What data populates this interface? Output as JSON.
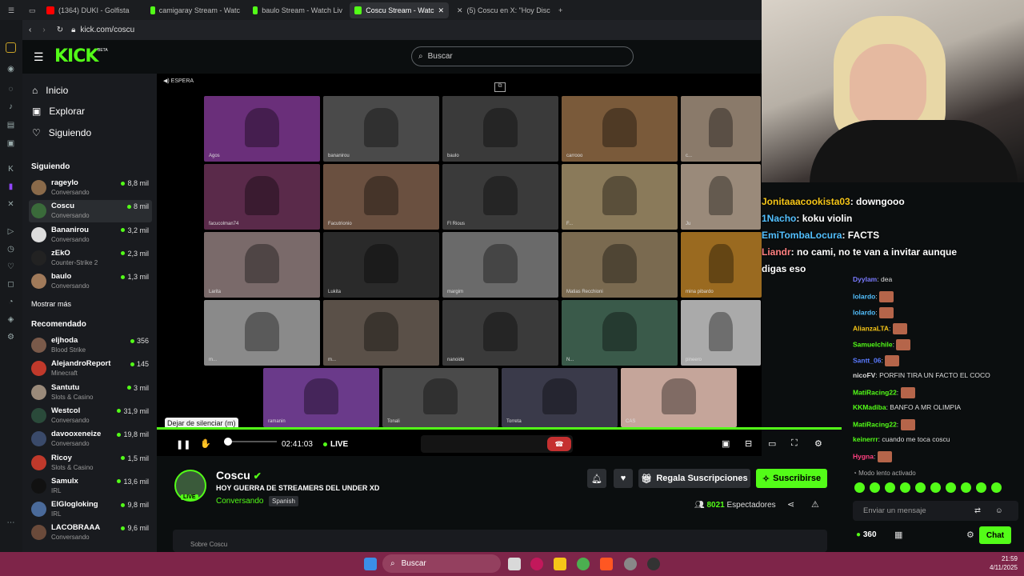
{
  "browser": {
    "tabs": [
      {
        "label": "(1364) DUKI - Golfista",
        "color": "#ff0000",
        "muted": true
      },
      {
        "label": "camigaray Stream - Watc",
        "color": "#53fc18"
      },
      {
        "label": "baulo Stream - Watch Liv",
        "color": "#53fc18"
      },
      {
        "label": "Coscu Stream - Watc",
        "color": "#53fc18",
        "active": true
      },
      {
        "label": "(5) Coscu en X: \"Hoy Disc",
        "color": "#000000"
      }
    ],
    "url": "kick.com/coscu"
  },
  "header": {
    "logo": "KICK",
    "beta": "BETA",
    "search_placeholder": "Buscar"
  },
  "nav": {
    "main": [
      {
        "label": "Inicio",
        "icon": "home-icon"
      },
      {
        "label": "Explorar",
        "icon": "explore-icon"
      },
      {
        "label": "Siguiendo",
        "icon": "heart-icon"
      }
    ],
    "following_title": "Siguiendo",
    "following": [
      {
        "name": "rageylo",
        "category": "Conversando",
        "viewers": "8,8 mil",
        "color": "#8a6a4a"
      },
      {
        "name": "Coscu",
        "category": "Conversando",
        "viewers": "8 mil",
        "color": "#3a6a3a",
        "selected": true
      },
      {
        "name": "Bananirou",
        "category": "Conversando",
        "viewers": "3,2 mil",
        "color": "#dddddd"
      },
      {
        "name": "zEkO",
        "category": "Counter-Strike 2",
        "viewers": "2,3 mil",
        "color": "#222222"
      },
      {
        "name": "baulo",
        "category": "Conversando",
        "viewers": "1,3 mil",
        "color": "#a07a5a"
      }
    ],
    "show_more": "Mostrar más",
    "recommended_title": "Recomendado",
    "recommended": [
      {
        "name": "eljhoda",
        "category": "Blood Strike",
        "viewers": "356",
        "color": "#7a5a4a"
      },
      {
        "name": "AlejandroReport",
        "category": "Minecraft",
        "viewers": "145",
        "color": "#c0392b"
      },
      {
        "name": "Santutu",
        "category": "Slots & Casino",
        "viewers": "3 mil",
        "color": "#9a8a7a"
      },
      {
        "name": "Westcol",
        "category": "Conversando",
        "viewers": "31,9 mil",
        "color": "#2a4a3a"
      },
      {
        "name": "davooxeneize",
        "category": "Conversando",
        "viewers": "19,8 mil",
        "color": "#3a4a6a"
      },
      {
        "name": "Ricoy",
        "category": "Slots & Casino",
        "viewers": "1,5 mil",
        "color": "#c0392b"
      },
      {
        "name": "Samulx",
        "category": "IRL",
        "viewers": "13,6 mil",
        "color": "#111111"
      },
      {
        "name": "ElGlogloking",
        "category": "IRL",
        "viewers": "9,8 mil",
        "color": "#4a6a9a"
      },
      {
        "name": "LACOBRAAA",
        "category": "Conversando",
        "viewers": "9,6 mil",
        "color": "#6a4a3a"
      }
    ]
  },
  "player": {
    "status": "ESPERA",
    "tooltip": "Dejar de silenciar (m)",
    "time": "02:41:03",
    "live": "LIVE",
    "cams": [
      {
        "label": "Agos",
        "bg": "#6a2f7a"
      },
      {
        "label": "bananirou",
        "bg": "#4a4a4a"
      },
      {
        "label": "baulo",
        "bg": "#3a3a3a"
      },
      {
        "label": "carrooo",
        "bg": "#7a5a3a"
      },
      {
        "label": "c...",
        "bg": "#8a7a6a"
      },
      {
        "label": "facucolman74",
        "bg": "#5a2a4a"
      },
      {
        "label": "Facutrionio",
        "bg": "#6a5040"
      },
      {
        "label": "Fl Rious",
        "bg": "#3a3a3a"
      },
      {
        "label": "F...",
        "bg": "#8a7a5a"
      },
      {
        "label": "Ju",
        "bg": "#9a8a7a"
      },
      {
        "label": "Larita",
        "bg": "#7a6a6a"
      },
      {
        "label": "Lukita",
        "bg": "#2a2a2a"
      },
      {
        "label": "margim",
        "bg": "#6a6a6a"
      },
      {
        "label": "Matias Recchioni",
        "bg": "#7a6a50"
      },
      {
        "label": "mina pibardo",
        "bg": "#9a6a20"
      },
      {
        "label": "m...",
        "bg": "#8a8a8a"
      },
      {
        "label": "m...",
        "bg": "#5a5048"
      },
      {
        "label": "nanoide",
        "bg": "#3a3a3a"
      },
      {
        "label": "N...",
        "bg": "#3a5a4a"
      },
      {
        "label": "pineero",
        "bg": "#aaaaaa"
      },
      {
        "label": "ramanin",
        "bg": "#6a3a8a"
      },
      {
        "label": "Tonali",
        "bg": "#4a4a4a"
      },
      {
        "label": "Torreta",
        "bg": "#3a3a4a"
      },
      {
        "label": "CAS",
        "bg": "#c5a59a"
      }
    ]
  },
  "stream": {
    "name": "Coscu",
    "live": "LIVE",
    "title": "HOY GUERRA DE STREAMERS DEL UNDER XD",
    "category": "Conversando",
    "language": "Spanish",
    "gift_label": "Regala Suscripciones",
    "subscribe_label": "Suscribirse",
    "viewers": "8021",
    "viewers_label": "Espectadores",
    "about": "Sobre Coscu"
  },
  "overlay": [
    {
      "user": "Jonitaaacookista03",
      "text": ": downgooo",
      "color": "#f5c518"
    },
    {
      "user": "1Nacho",
      "text": ": koku violin",
      "color": "#53c0ff"
    },
    {
      "user": "EmiTombaLocura",
      "text": ": FACTS",
      "color": "#53c0ff"
    },
    {
      "user": "Liandr",
      "text": ": no cami, no te van a invitar aunque",
      "color": "#ff8080"
    },
    {
      "user": "",
      "text": "digas eso",
      "color": "#ffffff"
    }
  ],
  "chat": {
    "messages": [
      {
        "user": "Dyylam",
        "text": "dea",
        "color": "#7a7aff"
      },
      {
        "user": "lolardo",
        "text": "",
        "color": "#53c0ff",
        "emote": true
      },
      {
        "user": "lolardo",
        "text": "",
        "color": "#53c0ff",
        "emote": true
      },
      {
        "user": "AlianzaLTA",
        "text": "",
        "color": "#f5c518",
        "emote": true
      },
      {
        "user": "Samuelchile",
        "text": "",
        "color": "#53fc18",
        "emote": true
      },
      {
        "user": "Santt_06",
        "text": "",
        "color": "#5a7aff",
        "emote": true
      },
      {
        "user": "nicoFV",
        "text": "PORFIN TIRA UN FACTO EL COCO",
        "color": "#dddddd"
      },
      {
        "user": "MatiRacing22",
        "text": "",
        "color": "#53fc18",
        "emote": true
      },
      {
        "user": "KKMadiba",
        "text": "BANFO A MR OLIMPIA",
        "color": "#53fc18"
      },
      {
        "user": "MatiRacing22",
        "text": "",
        "color": "#53fc18",
        "emote": true
      },
      {
        "user": "keinerrr",
        "text": "cuando me toca coscu",
        "color": "#53fc18"
      },
      {
        "user": "Hygna",
        "text": "",
        "color": "#ff4080",
        "emote": true
      }
    ],
    "slow_mode": "Modo lento activado",
    "input_placeholder": "Enviar un mensaje",
    "points": "360",
    "send_label": "Chat"
  },
  "taskbar": {
    "search": "Buscar",
    "time": "21:59",
    "date": "4/11/2025"
  },
  "colors": {
    "accent": "#53fc18",
    "bg": "#0b0e0f",
    "panel": "#191b1f"
  }
}
